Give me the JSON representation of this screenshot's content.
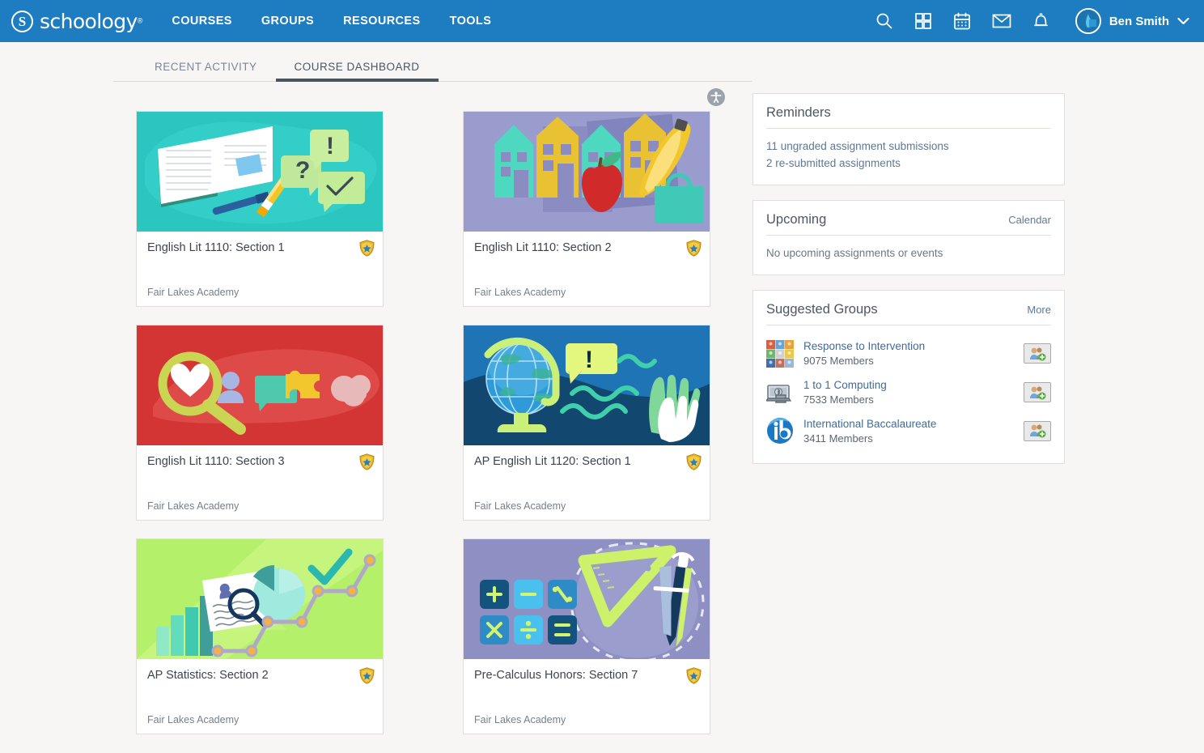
{
  "brand": {
    "logo_text": "schoology",
    "logo_mark": "S",
    "trademark": "®",
    "header_color": "#1d7dc0"
  },
  "nav": {
    "links": [
      {
        "label": "COURSES",
        "name": "nav-courses"
      },
      {
        "label": "GROUPS",
        "name": "nav-groups"
      },
      {
        "label": "RESOURCES",
        "name": "nav-resources"
      },
      {
        "label": "TOOLS",
        "name": "nav-tools"
      }
    ],
    "icons": [
      "search-icon",
      "apps-grid-icon",
      "calendar-icon",
      "messages-envelope-icon",
      "notifications-bell-icon"
    ],
    "user_name": "Ben Smith",
    "caret": "▾"
  },
  "tabs": [
    {
      "label": "RECENT ACTIVITY",
      "active": false
    },
    {
      "label": "COURSE DASHBOARD",
      "active": true
    }
  ],
  "accessibility_icon": "accessibility-icon",
  "courses": [
    {
      "title": "English Lit 1110: Section 1",
      "school": "Fair Lakes Academy",
      "badge": "course-shield-badge",
      "thumb": "book-notes-illustration",
      "bg": "#2cc6c0"
    },
    {
      "title": "English Lit 1110: Section 2",
      "school": "Fair Lakes Academy",
      "badge": "course-shield-badge",
      "thumb": "houses-food-illustration",
      "bg": "#9a9ccd"
    },
    {
      "title": "English Lit 1110: Section 3",
      "school": "Fair Lakes Academy",
      "badge": "course-shield-badge",
      "thumb": "magnifier-heart-illustration",
      "bg": "#d33434"
    },
    {
      "title": "AP English Lit 1120: Section 1",
      "school": "Fair Lakes Academy",
      "badge": "course-shield-badge",
      "thumb": "globe-waves-hands-illustration",
      "bg": "#1f74b5"
    },
    {
      "title": "AP Statistics: Section 2",
      "school": "Fair Lakes Academy",
      "badge": "course-shield-badge",
      "thumb": "charts-graphs-illustration",
      "bg": "#b4f06a"
    },
    {
      "title": "Pre-Calculus Honors: Section 7",
      "school": "Fair Lakes Academy",
      "badge": "course-shield-badge",
      "thumb": "math-symbols-illustration",
      "bg": "#8e90c4"
    }
  ],
  "reminders": {
    "title": "Reminders",
    "items": [
      "11 ungraded assignment submissions",
      "2 re-submitted assignments"
    ]
  },
  "upcoming": {
    "title": "Upcoming",
    "action": "Calendar",
    "empty_text": "No upcoming assignments or events"
  },
  "suggested_groups": {
    "title": "Suggested Groups",
    "action": "More",
    "items": [
      {
        "name": "Response to Intervention",
        "members": "9075 Members",
        "icon": "rti-grid-icon",
        "add": "add-to-group-button"
      },
      {
        "name": "1 to 1 Computing",
        "members": "7533 Members",
        "icon": "laptop-icon",
        "add": "add-to-group-button"
      },
      {
        "name": "International Baccalaureate",
        "members": "3411 Members",
        "icon": "ib-logo-icon",
        "add": "add-to-group-button"
      }
    ]
  }
}
